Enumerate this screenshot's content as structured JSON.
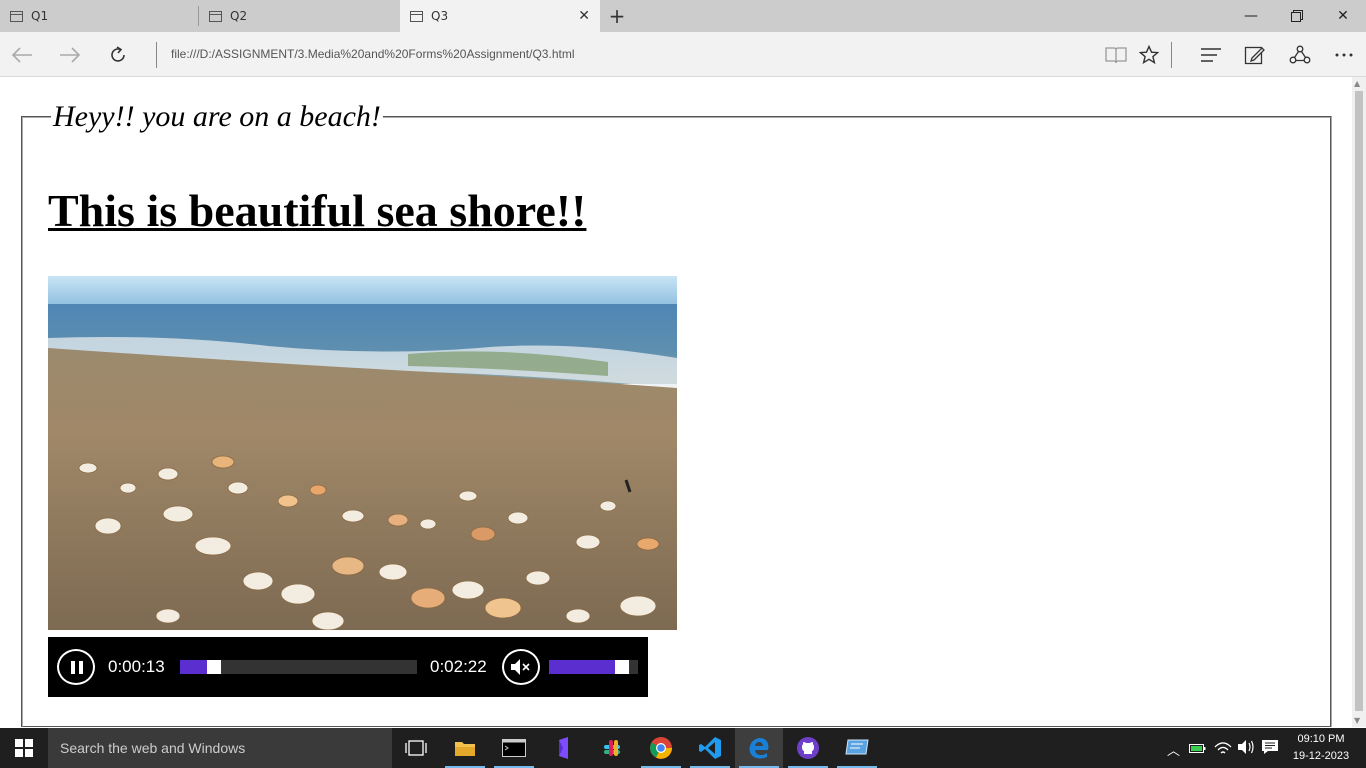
{
  "browser": {
    "tabs": [
      {
        "label": "Q1"
      },
      {
        "label": "Q2"
      },
      {
        "label": "Q3",
        "active": true
      }
    ],
    "url": "file:///D:/ASSIGNMENT/3.Media%20and%20Forms%20Assignment/Q3.html"
  },
  "page": {
    "legend": "Heyy!! you are on a beach!",
    "heading": "This is beautiful sea shore!!",
    "video": {
      "current_time": "0:00:13",
      "duration": "0:02:22",
      "progress": 0.12,
      "volume": 0.88,
      "muted": true,
      "accent_color": "#5b2fcf"
    }
  },
  "taskbar": {
    "search_placeholder": "Search the web and Windows",
    "apps": [
      "task-view",
      "file-explorer",
      "command-prompt",
      "visual-studio",
      "slack",
      "chrome",
      "vscode",
      "edge",
      "github-desktop",
      "remote-desktop"
    ],
    "clock_time": "09:10 PM",
    "clock_date": "19-12-2023"
  }
}
